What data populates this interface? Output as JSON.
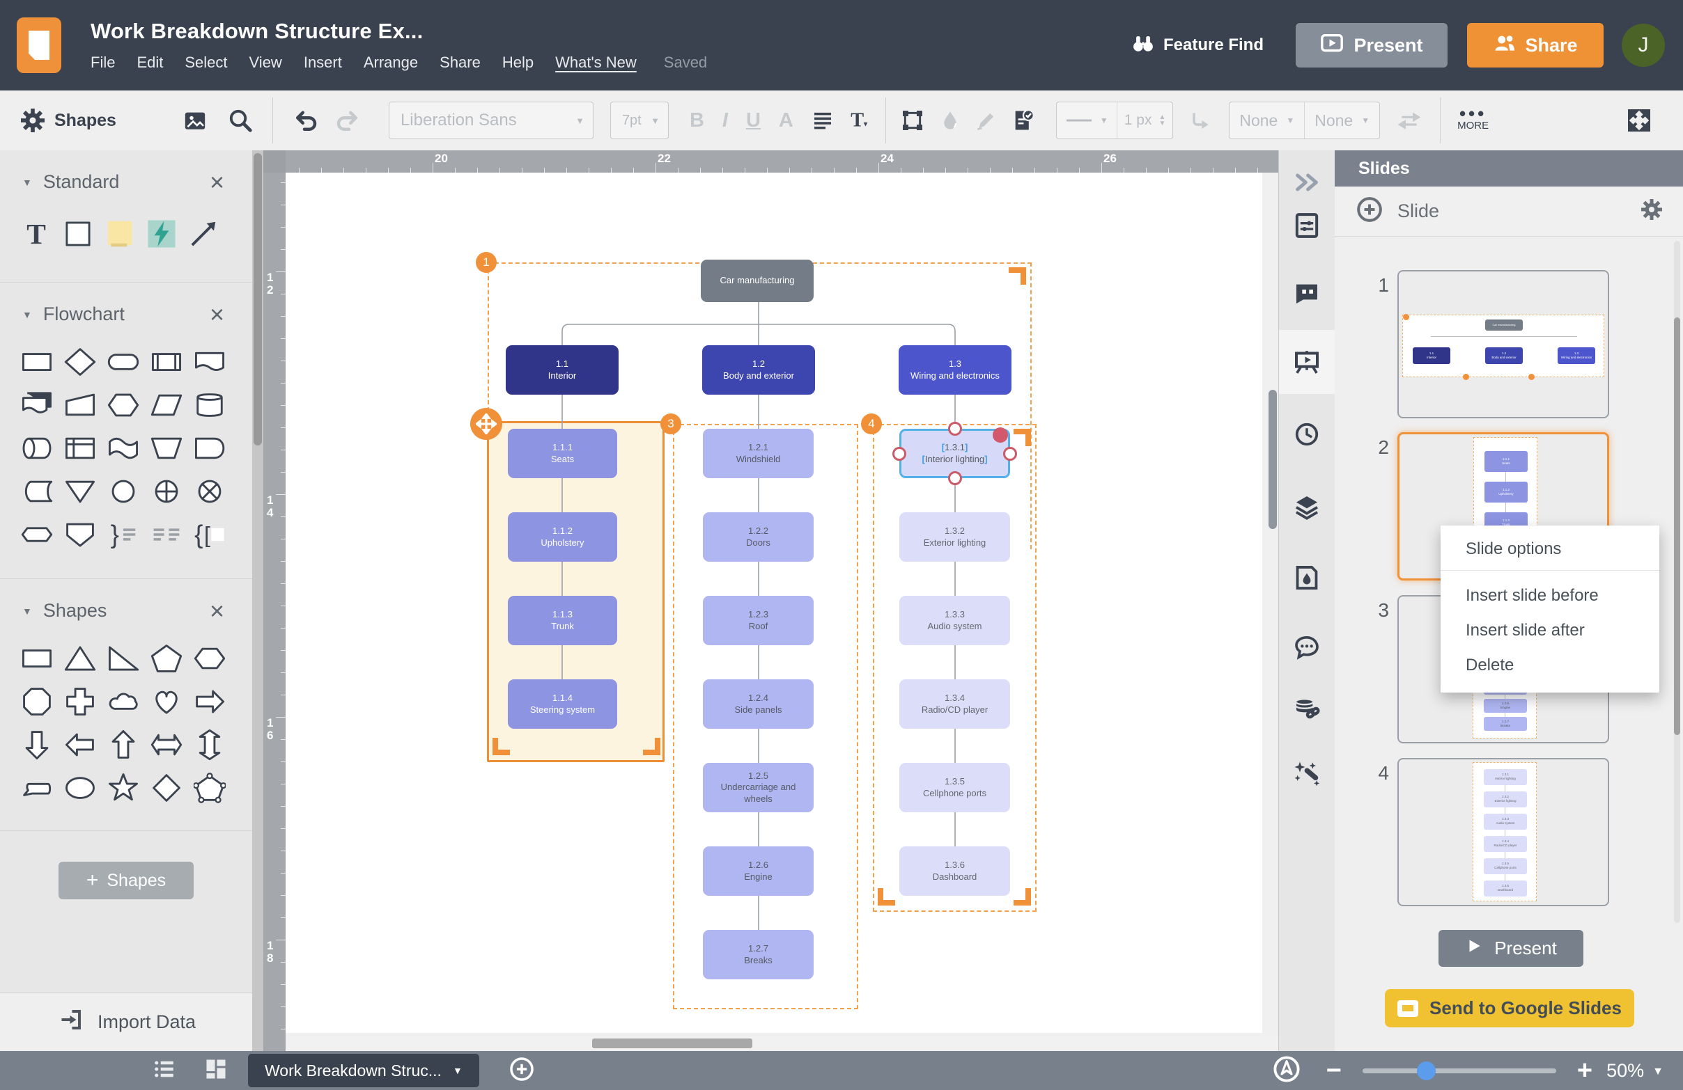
{
  "topbar": {
    "title": "Work Breakdown Structure Ex...",
    "menus": [
      "File",
      "Edit",
      "Select",
      "View",
      "Insert",
      "Arrange",
      "Share",
      "Help",
      "What's New"
    ],
    "saved_status": "Saved",
    "feature_find": "Feature Find",
    "present_label": "Present",
    "share_label": "Share",
    "avatar_initial": "J"
  },
  "toolbar": {
    "shapes_label": "Shapes",
    "font_family": "Liberation Sans",
    "font_size": "7pt",
    "bold": "B",
    "italic": "I",
    "underline": "U",
    "text_color": "A",
    "line_width": "1 px",
    "line_start": "None",
    "line_end": "None",
    "more_label": "MORE"
  },
  "left_panel": {
    "sections": [
      {
        "title": "Standard",
        "shapes": [
          "text",
          "rectangle",
          "sticky-note",
          "lightning-bolt",
          "arrow"
        ]
      },
      {
        "title": "Flowchart",
        "shapes": [
          "process",
          "decision",
          "terminator",
          "predefined-process",
          "document",
          "multiple-documents",
          "manual-input",
          "preparation",
          "data",
          "database",
          "direct-access-storage",
          "internal-storage",
          "paper-tape",
          "manual-operation",
          "delay",
          "stored-data",
          "merge",
          "connector",
          "or-junction",
          "summing-junction",
          "off-page-link",
          "off-page-reference",
          "brace-note",
          "annotation-lines",
          "bracket-note"
        ]
      },
      {
        "title": "Shapes",
        "shapes": [
          "rectangle2",
          "triangle",
          "right-triangle",
          "pentagon",
          "hexagon",
          "octagon",
          "cross",
          "cloud",
          "heart",
          "arrow-right",
          "arrow-down",
          "arrow-left",
          "arrow-up",
          "arrow-left-right",
          "arrow-up-down",
          "callout",
          "ellipse",
          "star",
          "diamond",
          "polygon-editable"
        ]
      }
    ],
    "add_shapes_label": "Shapes",
    "import_data_label": "Import Data"
  },
  "canvas": {
    "ruler_top_labels": [
      "20",
      "22",
      "24",
      "26"
    ],
    "ruler_left_labels": [
      "12",
      "14",
      "16",
      "18"
    ]
  },
  "diagram": {
    "root": {
      "label": "Car manufacturing"
    },
    "branches": [
      {
        "id": "1.1",
        "title": "Interior",
        "children": [
          {
            "id": "1.1.1",
            "title": "Seats"
          },
          {
            "id": "1.1.2",
            "title": "Upholstery"
          },
          {
            "id": "1.1.3",
            "title": "Trunk"
          },
          {
            "id": "1.1.4",
            "title": "Steering system"
          }
        ]
      },
      {
        "id": "1.2",
        "title": "Body and exterior",
        "children": [
          {
            "id": "1.2.1",
            "title": "Windshield"
          },
          {
            "id": "1.2.2",
            "title": "Doors"
          },
          {
            "id": "1.2.3",
            "title": "Roof"
          },
          {
            "id": "1.2.4",
            "title": "Side panels"
          },
          {
            "id": "1.2.5",
            "title": "Undercarriage and wheels"
          },
          {
            "id": "1.2.6",
            "title": "Engine"
          },
          {
            "id": "1.2.7",
            "title": "Breaks"
          }
        ]
      },
      {
        "id": "1.3",
        "title": "Wiring and electronics",
        "children": [
          {
            "id": "1.3.1",
            "title": "Interior lighting"
          },
          {
            "id": "1.3.2",
            "title": "Exterior lighting"
          },
          {
            "id": "1.3.3",
            "title": "Audio system"
          },
          {
            "id": "1.3.4",
            "title": "Radio/CD player"
          },
          {
            "id": "1.3.5",
            "title": "Cellphone ports"
          },
          {
            "id": "1.3.6",
            "title": "Dashboard"
          }
        ]
      }
    ],
    "selected_node": "1.3.1",
    "region_badges": [
      "1",
      "move",
      "3",
      "4"
    ]
  },
  "slides_panel": {
    "title": "Slides",
    "add_slide_label": "Slide",
    "slides": [
      {
        "number": "1",
        "type": "overview",
        "selected": false
      },
      {
        "number": "2",
        "type": "column",
        "branch": 0,
        "selected": true
      },
      {
        "number": "3",
        "type": "column",
        "branch": 1,
        "selected": false
      },
      {
        "number": "4",
        "type": "column",
        "branch": 2,
        "selected": false
      }
    ],
    "present_label": "Present",
    "send_label": "Send to Google Slides"
  },
  "context_menu": {
    "title": "Slide options",
    "items": [
      "Insert slide before",
      "Insert slide after",
      "Delete"
    ]
  },
  "bottom_bar": {
    "tab_label": "Work Breakdown Struc...",
    "zoom_level": "50%"
  },
  "colors": {
    "accent_orange": "#f0913a",
    "topbar": "#39424e",
    "root_box": "#747c87",
    "branch_colors": [
      "#303589",
      "#3d46ae",
      "#4c55cc"
    ],
    "child_colors": [
      "#8d94e2",
      "#b0b6f2",
      "#dcdef9"
    ],
    "child_text_colors": [
      "#ffffff",
      "#555b63",
      "#63686f"
    ],
    "selection_blue": "#54b0e8",
    "handle_red": "#cc5a68",
    "google_yellow": "#f0c232",
    "slider_blue": "#5c9cec",
    "group_fill": "#fdf4df"
  }
}
